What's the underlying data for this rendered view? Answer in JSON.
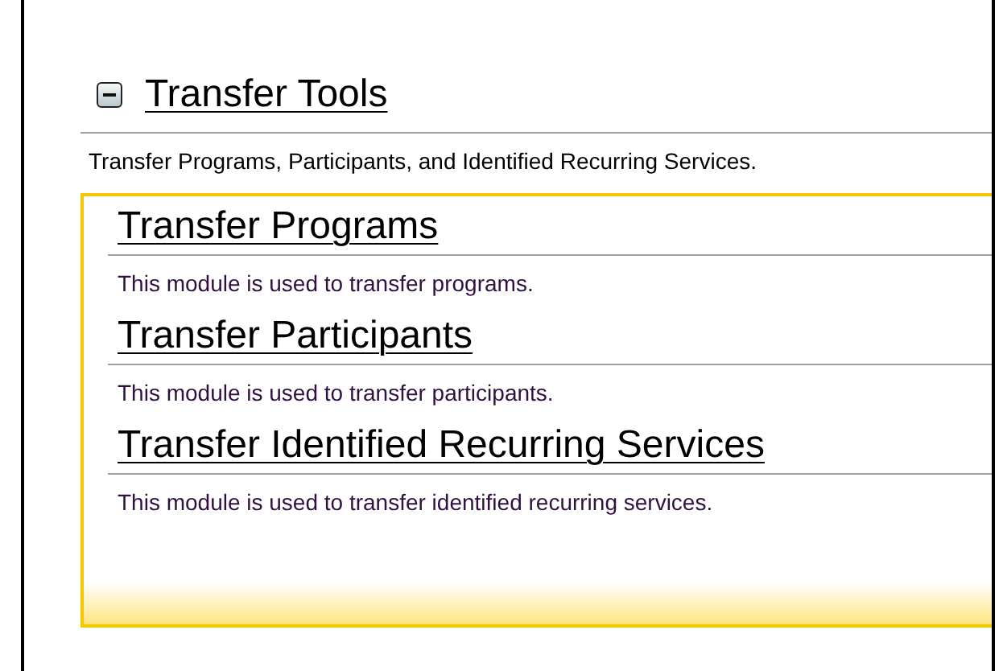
{
  "section": {
    "title": "Transfer Tools",
    "expanded": true,
    "description": "Transfer Programs, Participants, and Identified Recurring Services.",
    "modules": [
      {
        "title": "Transfer Programs",
        "description": "This module is used to transfer programs."
      },
      {
        "title": "Transfer Participants",
        "description": "This module is used to transfer participants."
      },
      {
        "title": "Transfer Identified Recurring Services",
        "description": "This module is used to transfer identified recurring services."
      }
    ]
  }
}
